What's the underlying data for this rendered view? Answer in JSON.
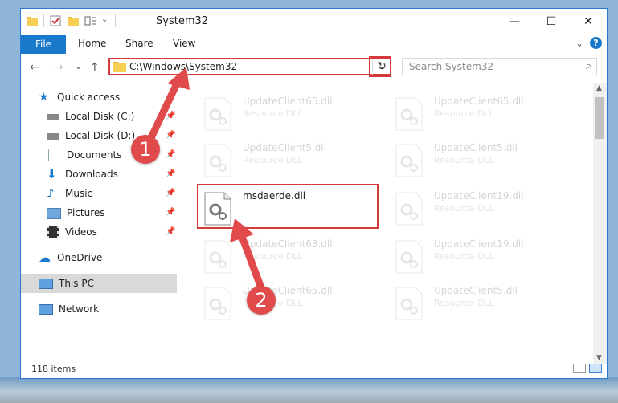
{
  "window": {
    "title": "System32"
  },
  "window_controls": {
    "minimize": "—",
    "maximize": "☐",
    "close": "✕"
  },
  "ribbon": {
    "tabs": [
      "File",
      "Home",
      "Share",
      "View"
    ],
    "expand": "⌄",
    "help": "?"
  },
  "navbar": {
    "back": "←",
    "forward": "→",
    "recent": "⌄",
    "up": "↑",
    "address_path": "C:\\Windows\\System32",
    "address_dropdown": "⌄",
    "refresh": "↻",
    "search_placeholder": "Search System32",
    "search_icon": "⌕"
  },
  "nav_pane": {
    "items": [
      {
        "label": "Quick access",
        "icon": "star-icon",
        "pinned": false
      },
      {
        "label": "Local Disk (C:)",
        "icon": "drive-icon",
        "pinned": true
      },
      {
        "label": "Local Disk (D:)",
        "icon": "drive-icon",
        "pinned": true
      },
      {
        "label": "Documents",
        "icon": "documents-icon",
        "pinned": true
      },
      {
        "label": "Downloads",
        "icon": "downloads-icon",
        "pinned": true
      },
      {
        "label": "Music",
        "icon": "music-icon",
        "pinned": true
      },
      {
        "label": "Pictures",
        "icon": "pictures-icon",
        "pinned": true
      },
      {
        "label": "Videos",
        "icon": "videos-icon",
        "pinned": true
      },
      {
        "label": "OneDrive",
        "icon": "cloud-icon",
        "pinned": false
      },
      {
        "label": "This PC",
        "icon": "computer-icon",
        "pinned": false,
        "selected": true
      },
      {
        "label": "Network",
        "icon": "network-icon",
        "pinned": false
      }
    ],
    "pin_glyph": "📌"
  },
  "files": {
    "left_column": [
      {
        "name": "UpdateClient65.dll",
        "type": "Resource DLL",
        "faded": true
      },
      {
        "name": "UpdateClient5.dll",
        "type": "Resource DLL",
        "faded": true
      },
      {
        "name": "msdaerde.dll",
        "type": "",
        "faded": false,
        "highlighted": true
      },
      {
        "name": "UpdateClient63.dll",
        "type": "Resource DLL",
        "faded": true
      },
      {
        "name": "UpdateClient65.dll",
        "type": "Resource DLL",
        "faded": true
      }
    ],
    "right_column": [
      {
        "name": "UpdateClient65.dll",
        "type": "Resource DLL",
        "faded": true
      },
      {
        "name": "UpdateClient5.dll",
        "type": "Resource DLL",
        "faded": true
      },
      {
        "name": "UpdateClient19.dll",
        "type": "Resource DLL",
        "faded": true
      },
      {
        "name": "UpdateClient19.dll",
        "type": "Resource DLL",
        "faded": true
      },
      {
        "name": "UpdateClient5.dll",
        "type": "Resource DLL",
        "faded": true
      }
    ]
  },
  "status_bar": {
    "item_count": "118 items"
  },
  "annotations": {
    "step1": "1",
    "step2": "2",
    "color": "#e04a4a"
  },
  "colors": {
    "accent": "#1979ca",
    "highlight": "#d33a3a",
    "selected_nav": "#d9d9d9"
  }
}
